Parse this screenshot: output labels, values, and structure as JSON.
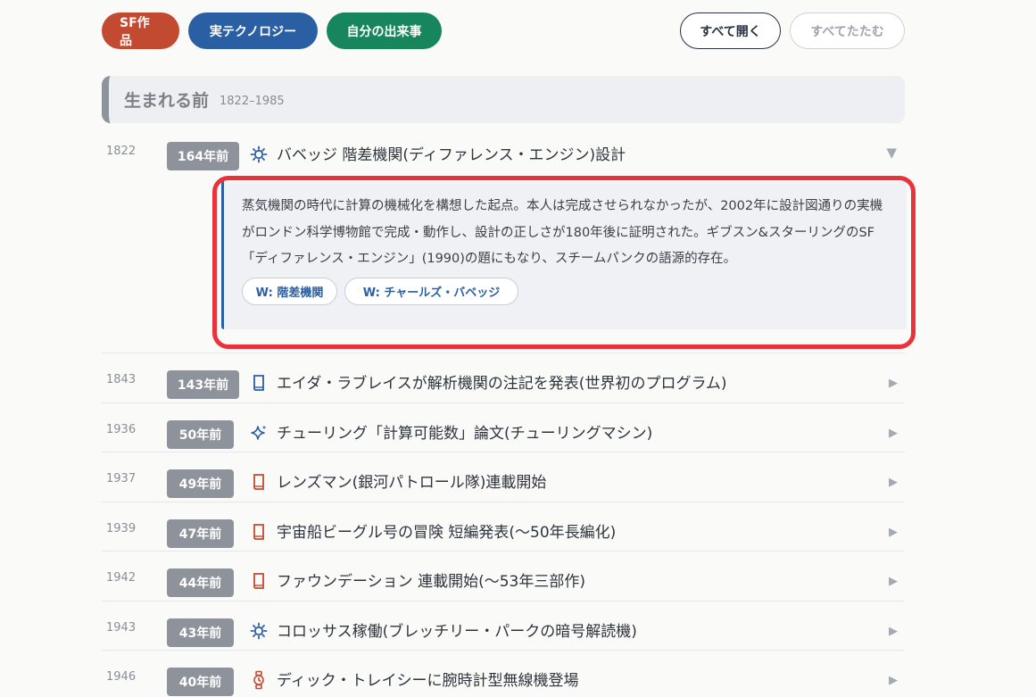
{
  "filters": {
    "sf": {
      "label": "SF作品",
      "color": "#c24a30"
    },
    "tech": {
      "label": "実テクノロジー",
      "color": "#2b5fa3"
    },
    "self": {
      "label": "自分の出来事",
      "color": "#17865d"
    }
  },
  "controls": {
    "expand_all": "すべて開く",
    "collapse_all": "すべてたたむ"
  },
  "era": {
    "title": "生まれる前",
    "range": "1822–1985"
  },
  "colors": {
    "tech_icon": "#2b5fa3",
    "sf_icon": "#c24a30",
    "highlight": "#e8333b"
  },
  "events": [
    {
      "year": "1822",
      "ago": "164年前",
      "icon": "gear-icon",
      "title": "バベッジ 階差機関(ディファレンス・エンジン)設計",
      "expanded": true,
      "description": "蒸気機関の時代に計算の機械化を構想した起点。本人は完成させられなかったが、2002年に設計図通りの実機がロンドン科学博物館で完成・動作し、設計の正しさが180年後に証明された。ギブスン&スターリングのSF「ディファレンス・エンジン」(1990)の題にもなり、スチームパンクの語源的存在。",
      "tags": [
        "W: 階差機関",
        "W: チャールズ・バベッジ"
      ]
    },
    {
      "year": "1843",
      "ago": "143年前",
      "icon": "book-icon-blue",
      "title": "エイダ・ラブレイスが解析機関の注記を発表(世界初のプログラム)"
    },
    {
      "year": "1936",
      "ago": "50年前",
      "icon": "sparkle-icon",
      "title": "チューリング「計算可能数」論文(チューリングマシン)"
    },
    {
      "year": "1937",
      "ago": "49年前",
      "icon": "book-icon-red",
      "title": "レンズマン(銀河パトロール隊)連載開始"
    },
    {
      "year": "1939",
      "ago": "47年前",
      "icon": "book-icon-red",
      "title": "宇宙船ビーグル号の冒険 短編発表(〜50年長編化)"
    },
    {
      "year": "1942",
      "ago": "44年前",
      "icon": "book-icon-red",
      "title": "ファウンデーション 連載開始(〜53年三部作)"
    },
    {
      "year": "1943",
      "ago": "43年前",
      "icon": "gear-icon",
      "title": "コロッサス稼働(ブレッチリー・パークの暗号解読機)"
    },
    {
      "year": "1946",
      "ago": "40年前",
      "icon": "watch-icon",
      "title": "ディック・トレイシーに腕時計型無線機登場"
    }
  ]
}
